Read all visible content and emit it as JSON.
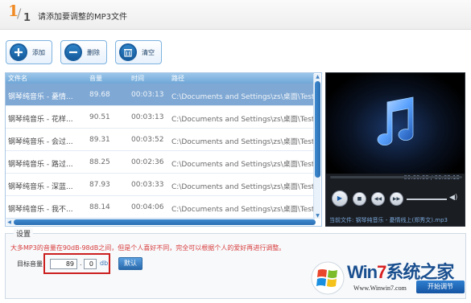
{
  "header": {
    "step_current": "1",
    "step_total": "1",
    "title": "请添加要调整的MP3文件"
  },
  "toolbar": {
    "add_label": "添加",
    "delete_label": "删除",
    "clear_label": "清空"
  },
  "list": {
    "columns": [
      "文件名",
      "音量",
      "时间",
      "路径"
    ],
    "rows": [
      {
        "name": "钢琴纯音乐 - 憂情...",
        "volume": "89.68",
        "time": "00:03:13",
        "path": "C:\\Documents and Settings\\zs\\桌面\\Test\\钢",
        "selected": true
      },
      {
        "name": "钢琴纯音乐 - 花样...",
        "volume": "90.51",
        "time": "00:03:13",
        "path": "C:\\Documents and Settings\\zs\\桌面\\Test\\钢",
        "selected": false
      },
      {
        "name": "钢琴纯音乐 - 会过...",
        "volume": "89.31",
        "time": "00:03:52",
        "path": "C:\\Documents and Settings\\zs\\桌面\\Test\\钢",
        "selected": false
      },
      {
        "name": "钢琴纯音乐 - 路过...",
        "volume": "88.25",
        "time": "00:02:36",
        "path": "C:\\Documents and Settings\\zs\\桌面\\Test\\钢",
        "selected": false
      },
      {
        "name": "钢琴纯音乐 - 深蓝...",
        "volume": "87.93",
        "time": "00:03:33",
        "path": "C:\\Documents and Settings\\zs\\桌面\\Test\\钢",
        "selected": false
      },
      {
        "name": "钢琴纯音乐 - 我不...",
        "volume": "88.14",
        "time": "00:04:06",
        "path": "C:\\Documents and Settings\\zs\\桌面\\Test\\钢",
        "selected": false
      }
    ]
  },
  "player": {
    "time_display": "00:00:00 / 00:03:13",
    "now_playing": "当前文件: 钢琴纯音乐 - 憂情线上(郑秀文).mp3",
    "play_symbol": "▶",
    "stop_symbol": "■",
    "prev_symbol": "◀◀",
    "next_symbol": "▶▶",
    "volume_symbol": "◀)"
  },
  "settings": {
    "title": "设置",
    "description": "大多MP3的音量在90dB-98dB之间，但是个人喜好不同，完全可以根据个人的爱好再进行调整。",
    "gain_label": "目标音量",
    "gain_int": "89",
    "gain_dot": ".",
    "gain_dec": "0",
    "gain_unit": "db",
    "default_button": "默认"
  },
  "actions": {
    "start_button": "开始调节"
  },
  "watermark": {
    "brand_prefix": "Win",
    "brand_seven": "7",
    "brand_suffix": "系统之家",
    "url": "Www.Winwin7.com"
  },
  "colors": {
    "accent": "#2a6fb3",
    "selected_row": "#7fa8d4",
    "highlight_box": "#cc1f1f",
    "warning_text": "#d93c3c",
    "step_number": "#f08a24"
  }
}
